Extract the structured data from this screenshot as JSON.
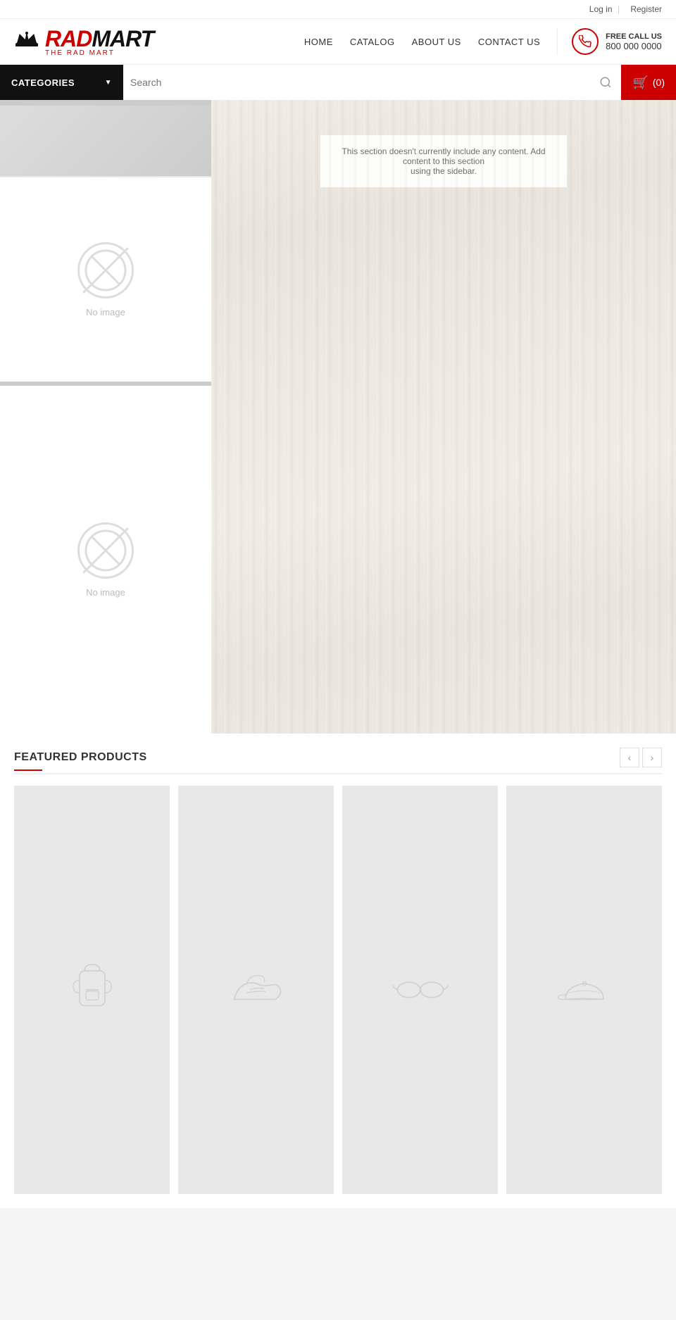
{
  "topbar": {
    "login_label": "Log in",
    "divider": "|",
    "register_label": "Register"
  },
  "header": {
    "logo_rad": "RAD",
    "logo_mart": "MART",
    "logo_sub": "THE RAD MART",
    "nav": {
      "home": "HOME",
      "catalog": "CATALOG",
      "about": "ABOUT US",
      "contact": "CONTACT US"
    },
    "call": {
      "free_label": "FREE CALL US",
      "number": "800 000 0000"
    }
  },
  "searchbar": {
    "categories_label": "CATEGORIES",
    "search_placeholder": "Search",
    "cart_label": "0",
    "cart_count": "(0)"
  },
  "main": {
    "empty_msg_line1": "This section doesn't currently include any content. Add content to this section",
    "empty_msg_line2": "using the sidebar.",
    "product_card1": {
      "no_image": "No image"
    },
    "product_card2": {
      "no_image": "No image"
    }
  },
  "featured": {
    "title": "FEATURED PRODUCTS",
    "prev_btn": "‹",
    "next_btn": "›",
    "products": [
      {
        "icon": "backpack",
        "id": 1
      },
      {
        "icon": "sneaker",
        "id": 2
      },
      {
        "icon": "glasses",
        "id": 3
      },
      {
        "icon": "cap",
        "id": 4
      }
    ]
  }
}
